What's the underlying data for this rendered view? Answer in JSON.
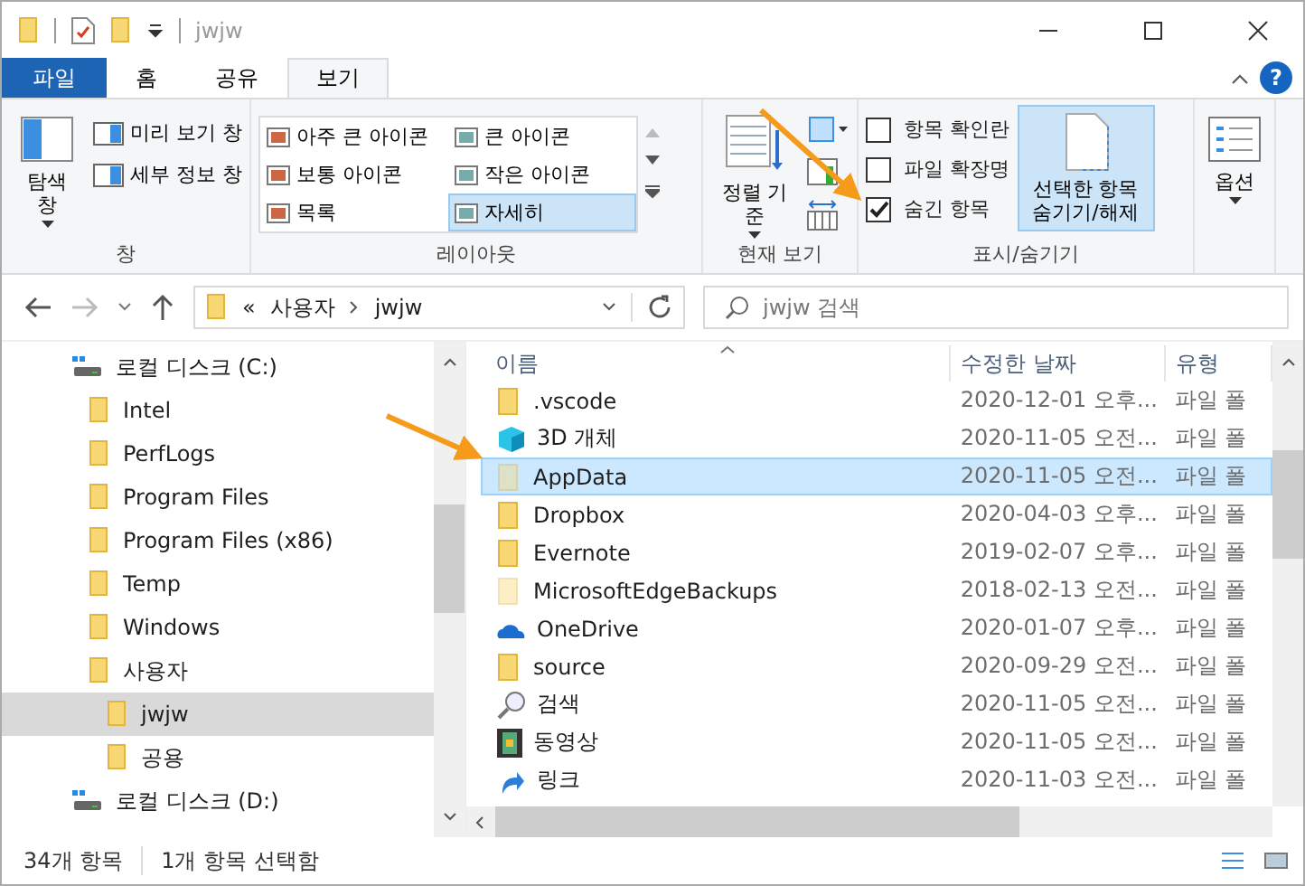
{
  "window": {
    "title": "jwjw"
  },
  "ribbon": {
    "tabs": [
      {
        "label": "파일",
        "kind": "file",
        "selected": false
      },
      {
        "label": "홈",
        "kind": "tab",
        "selected": false
      },
      {
        "label": "공유",
        "kind": "tab",
        "selected": false
      },
      {
        "label": "보기",
        "kind": "tab",
        "selected": true
      }
    ],
    "pane_group": {
      "label": "창",
      "nav_pane": "탐색 창",
      "preview_pane": "미리 보기 창",
      "details_pane": "세부 정보 창"
    },
    "layout_group": {
      "label": "레이아웃",
      "items": [
        {
          "label": "아주 큰 아이콘",
          "selected": false
        },
        {
          "label": "큰 아이콘",
          "selected": false
        },
        {
          "label": "보통 아이콘",
          "selected": false
        },
        {
          "label": "작은 아이콘",
          "selected": false
        },
        {
          "label": "목록",
          "selected": false
        },
        {
          "label": "자세히",
          "selected": true
        }
      ]
    },
    "current_view_group": {
      "label": "현재 보기",
      "sort_by": "정렬 기준"
    },
    "show_hide_group": {
      "label": "표시/숨기기",
      "checkboxes": [
        {
          "label": "항목 확인란",
          "checked": false
        },
        {
          "label": "파일 확장명",
          "checked": false
        },
        {
          "label": "숨긴 항목",
          "checked": true
        }
      ],
      "hide_selected": "선택한 항목 숨기기/해제"
    },
    "options": "옵션",
    "help": "?"
  },
  "address": {
    "prefix": "«",
    "path": [
      "사용자",
      "jwjw"
    ],
    "search_placeholder": "jwjw 검색"
  },
  "nav_tree": [
    {
      "label": "로컬 디스크 (C:)",
      "kind": "drive",
      "selected": false,
      "children": [
        {
          "label": "Intel",
          "kind": "folder",
          "selected": false
        },
        {
          "label": "PerfLogs",
          "kind": "folder",
          "selected": false
        },
        {
          "label": "Program Files",
          "kind": "folder",
          "selected": false
        },
        {
          "label": "Program Files (x86)",
          "kind": "folder",
          "selected": false
        },
        {
          "label": "Temp",
          "kind": "folder",
          "selected": false
        },
        {
          "label": "Windows",
          "kind": "folder",
          "selected": false
        },
        {
          "label": "사용자",
          "kind": "folder",
          "selected": false,
          "children": [
            {
              "label": "jwjw",
              "kind": "folder",
              "selected": true
            },
            {
              "label": "공용",
              "kind": "folder",
              "selected": false
            }
          ]
        }
      ]
    },
    {
      "label": "로컬 디스크 (D:)",
      "kind": "drive",
      "selected": false
    }
  ],
  "file_list": {
    "columns": [
      "이름",
      "수정한 날짜",
      "유형"
    ],
    "rows": [
      {
        "name": ".vscode",
        "kind": "folder",
        "hidden": false,
        "selected": false,
        "date": "2020-12-01 오후...",
        "type": "파일 폴"
      },
      {
        "name": "3D 개체",
        "kind": "cube",
        "hidden": false,
        "selected": false,
        "date": "2020-11-05 오전...",
        "type": "파일 폴"
      },
      {
        "name": "AppData",
        "kind": "folder",
        "hidden": true,
        "selected": true,
        "date": "2020-11-05 오전...",
        "type": "파일 폴"
      },
      {
        "name": "Dropbox",
        "kind": "folder",
        "hidden": false,
        "selected": false,
        "date": "2020-04-03 오후...",
        "type": "파일 폴"
      },
      {
        "name": "Evernote",
        "kind": "folder",
        "hidden": false,
        "selected": false,
        "date": "2019-02-07 오후...",
        "type": "파일 폴"
      },
      {
        "name": "MicrosoftEdgeBackups",
        "kind": "folder",
        "hidden": true,
        "selected": false,
        "date": "2018-02-13 오전...",
        "type": "파일 폴"
      },
      {
        "name": "OneDrive",
        "kind": "cloud",
        "hidden": false,
        "selected": false,
        "date": "2020-01-07 오후...",
        "type": "파일 폴"
      },
      {
        "name": "source",
        "kind": "folder",
        "hidden": false,
        "selected": false,
        "date": "2020-09-29 오전...",
        "type": "파일 폴"
      },
      {
        "name": "검색",
        "kind": "search",
        "hidden": false,
        "selected": false,
        "date": "2020-11-05 오전...",
        "type": "파일 폴"
      },
      {
        "name": "동영상",
        "kind": "video",
        "hidden": false,
        "selected": false,
        "date": "2020-11-05 오전...",
        "type": "파일 폴"
      },
      {
        "name": "링크",
        "kind": "link",
        "hidden": false,
        "selected": false,
        "date": "2020-11-03 오전...",
        "type": "파일 폴"
      }
    ]
  },
  "status_bar": {
    "count": "34개 항목",
    "selection": "1개 항목 선택함"
  }
}
